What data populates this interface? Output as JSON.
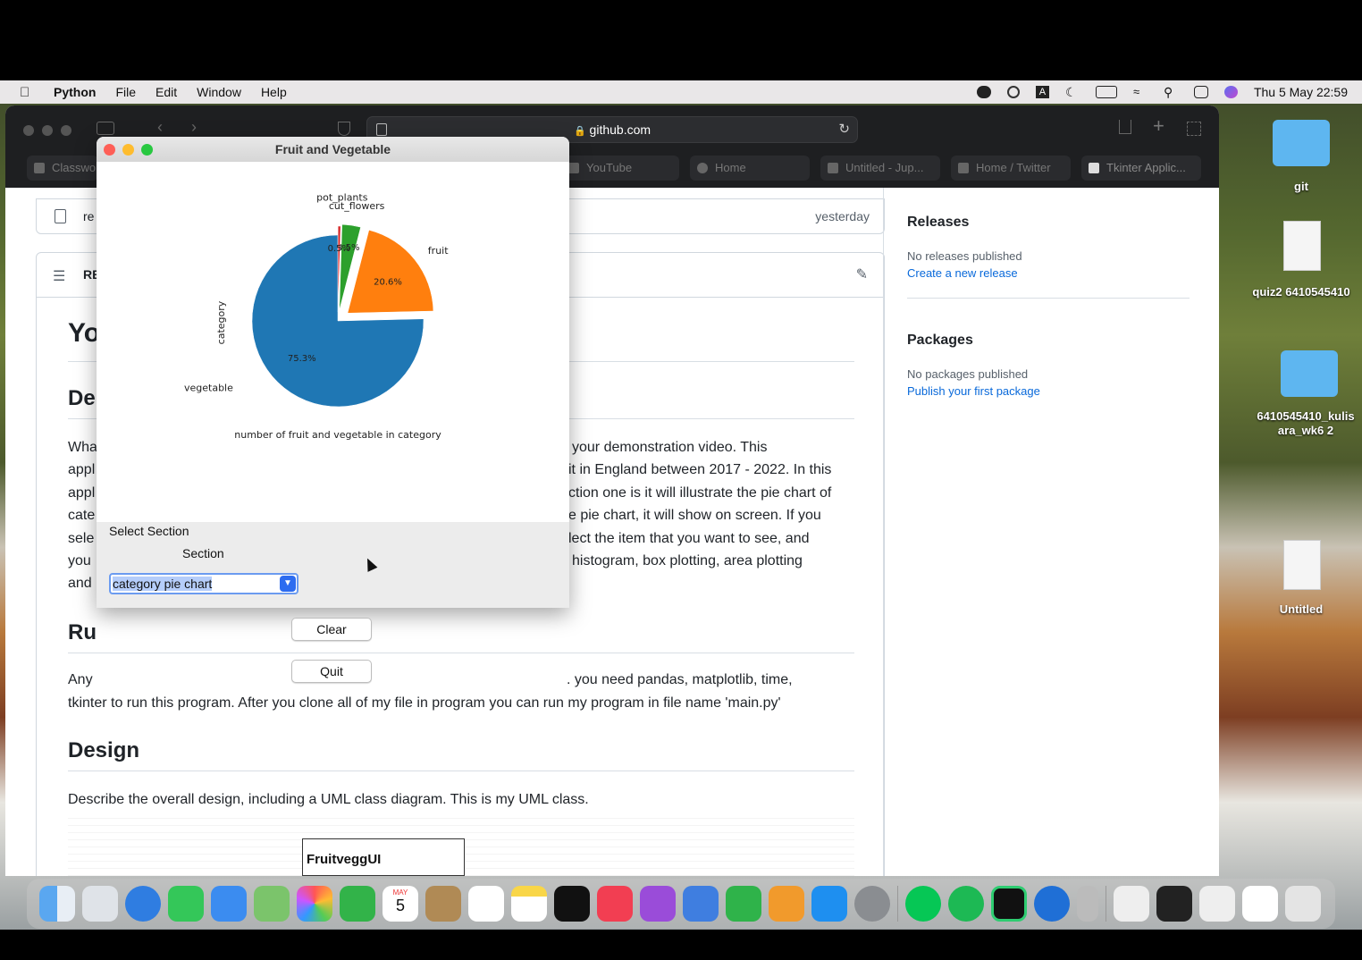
{
  "menubar": {
    "app_name": "Python",
    "items": [
      "File",
      "Edit",
      "Window",
      "Help"
    ],
    "clock": "Thu 5 May  22:59"
  },
  "safari": {
    "url": "github.com",
    "tabs": [
      "Classwo",
      "YouTube",
      "Home",
      "Untitled - Jup...",
      "Home / Twitter",
      "Tkinter Applic..."
    ],
    "github": {
      "file_row_name": "re",
      "file_row_time": "yesterday",
      "readme_header": "RE",
      "title_partial": "Yo",
      "desc_heading_partial": "De",
      "para_left": [
        "Wha",
        "appl",
        "appl",
        "cate",
        "sele",
        "you",
        "and"
      ],
      "para_right": [
        "your demonstration video. This",
        "it in England between 2017 - 2022. In this",
        "ction one is it will illustrate the pie chart of",
        "e pie chart, it will show on screen. If you",
        "lect the item that you want to see, and",
        "histogram, box plotting, area plotting",
        ""
      ],
      "run_heading_partial": "Ru",
      "run_line1_left": "Any",
      "run_line1_right": ". you need pandas, matplotlib, time,",
      "run_line2": "tkinter to run this program. After you clone all of my file in program you can run my program in file name 'main.py'",
      "design_heading": "Design",
      "design_text": "Describe the overall design, including a UML class diagram. This is my UML class.",
      "uml_class": "FruitveggUI",
      "releases_heading": "Releases",
      "releases_text": "No releases published",
      "releases_link": "Create a new release",
      "packages_heading": "Packages",
      "packages_text": "No packages published",
      "packages_link": "Publish your first package"
    }
  },
  "tk_window": {
    "title": "Fruit and Vegetable",
    "select_section_label": "Select Section",
    "section_label": "Section",
    "combo_value": "category pie chart",
    "clear_button": "Clear",
    "quit_button": "Quit"
  },
  "chart_data": {
    "type": "pie",
    "ylabel": "category",
    "xlabel": "number of fruit and vegetable in category",
    "categories": [
      "vegetable",
      "fruit",
      "cut_flowers",
      "pot_plants"
    ],
    "values": [
      75.3,
      20.6,
      3.5,
      0.5
    ],
    "labels": [
      "75.3%",
      "20.6%",
      "3.5%",
      "0.5%"
    ],
    "colors": [
      "#1f77b4",
      "#ff7f0e",
      "#2ca02c",
      "#d62728"
    ],
    "exploded": [
      "fruit",
      "cut_flowers",
      "pot_plants"
    ]
  },
  "desktop": {
    "icons": [
      "git",
      "quiz2 6410545410",
      "6410545410_kulis ara_wk6 2",
      "Untitled"
    ]
  },
  "dock": {
    "calendar_month": "MAY",
    "calendar_day": "5"
  }
}
